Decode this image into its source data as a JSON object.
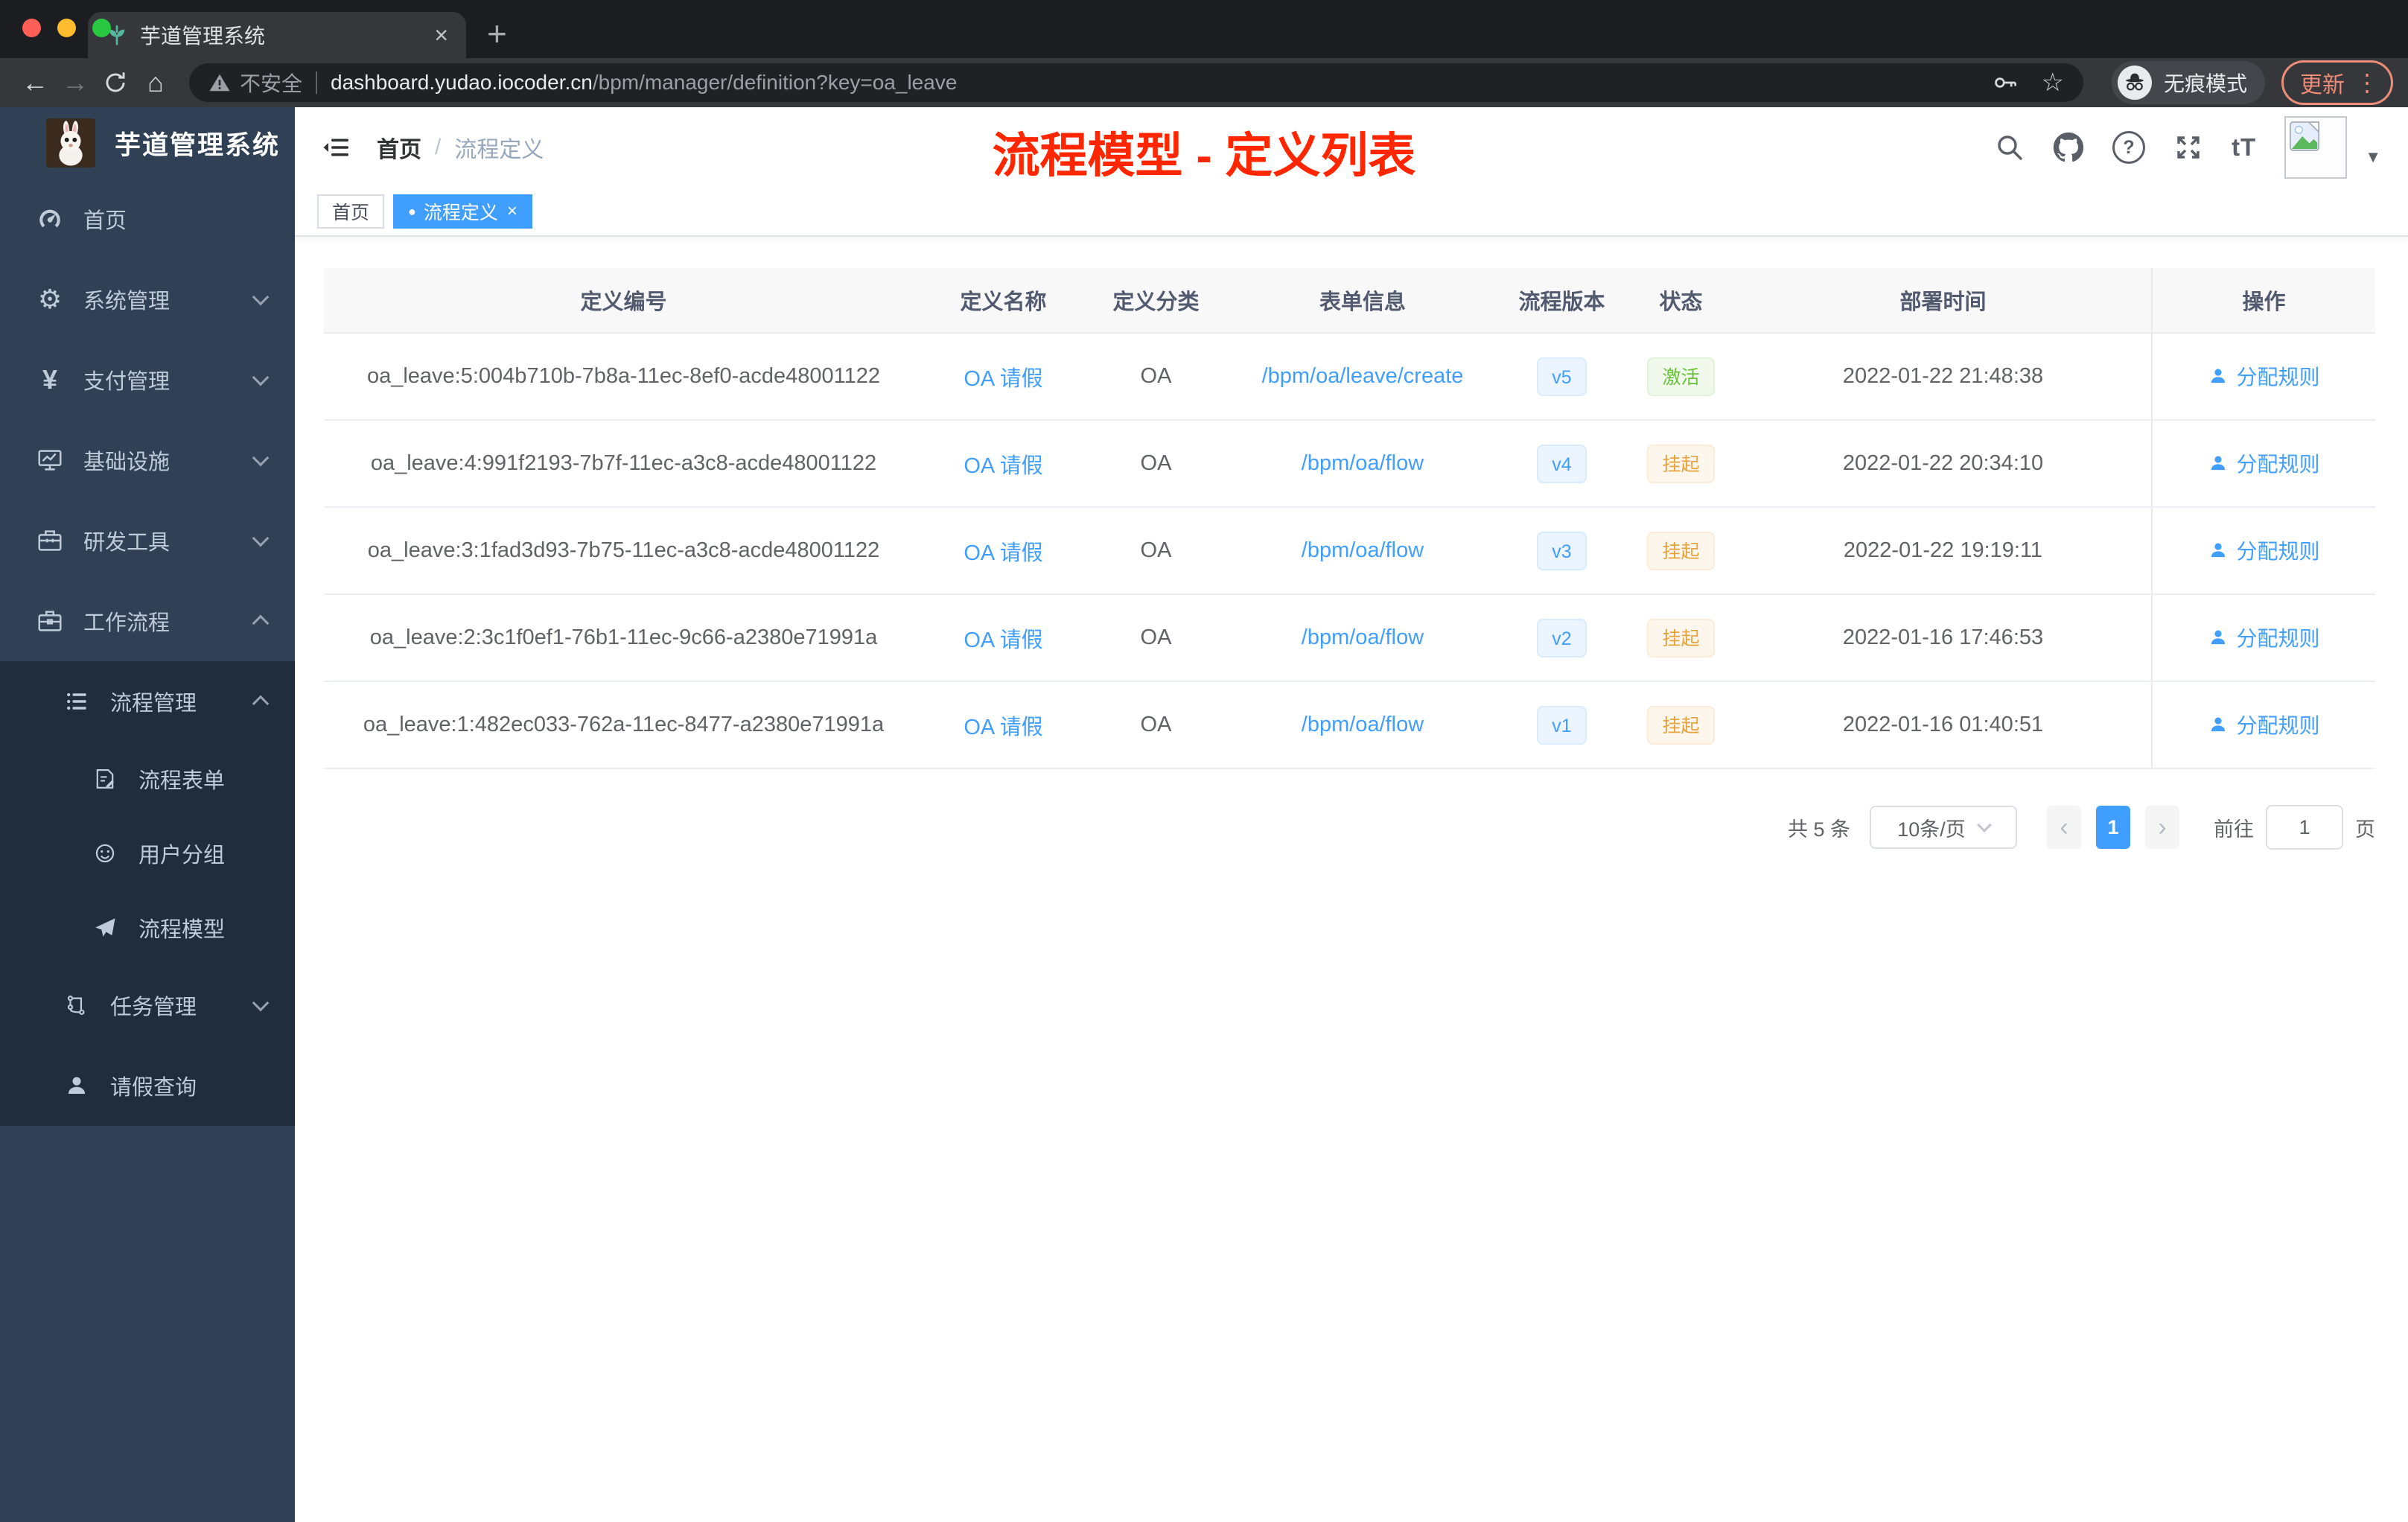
{
  "browser": {
    "tab_title": "芋道管理系统",
    "security_label": "不安全",
    "url_domain": "dashboard.yudao.iocoder.cn",
    "url_path": "/bpm/manager/definition?key=oa_leave",
    "incognito_label": "无痕模式",
    "update_label": "更新"
  },
  "icons": {
    "back": "←",
    "forward": "→",
    "home": "⌂",
    "star": "☆",
    "menu_dots": "⋮",
    "new_tab": "+",
    "tab_close": "×",
    "gear": "⚙",
    "yen": "¥",
    "question": "?",
    "font_size": "tT",
    "avatar_caret": "▼",
    "tag_dot": "●",
    "tag_close": "×",
    "prev": "‹",
    "next": "›",
    "breadcrumb_sep": "/"
  },
  "annotation": {
    "title": "流程模型 - 定义列表",
    "color": "#ff2600"
  },
  "sidebar": {
    "app_title": "芋道管理系统",
    "items": [
      {
        "label": "首页"
      },
      {
        "label": "系统管理"
      },
      {
        "label": "支付管理"
      },
      {
        "label": "基础设施"
      },
      {
        "label": "研发工具"
      },
      {
        "label": "工作流程"
      },
      {
        "label": "流程管理"
      },
      {
        "label": "流程表单"
      },
      {
        "label": "用户分组"
      },
      {
        "label": "流程模型"
      },
      {
        "label": "任务管理"
      },
      {
        "label": "请假查询"
      }
    ]
  },
  "header": {
    "breadcrumb_home": "首页",
    "breadcrumb_current": "流程定义"
  },
  "tags": [
    {
      "label": "首页",
      "active": false
    },
    {
      "label": "流程定义",
      "active": true
    }
  ],
  "table": {
    "columns": [
      "定义编号",
      "定义名称",
      "定义分类",
      "表单信息",
      "流程版本",
      "状态",
      "部署时间",
      "操作"
    ],
    "rows": [
      {
        "id": "oa_leave:5:004b710b-7b8a-11ec-8ef0-acde48001122",
        "name": "OA 请假",
        "category": "OA",
        "form": "/bpm/oa/leave/create",
        "version": "v5",
        "status": "激活",
        "status_type": "success",
        "deployed": "2022-01-22 21:48:38",
        "action": "分配规则"
      },
      {
        "id": "oa_leave:4:991f2193-7b7f-11ec-a3c8-acde48001122",
        "name": "OA 请假",
        "category": "OA",
        "form": "/bpm/oa/flow",
        "version": "v4",
        "status": "挂起",
        "status_type": "warning",
        "deployed": "2022-01-22 20:34:10",
        "action": "分配规则"
      },
      {
        "id": "oa_leave:3:1fad3d93-7b75-11ec-a3c8-acde48001122",
        "name": "OA 请假",
        "category": "OA",
        "form": "/bpm/oa/flow",
        "version": "v3",
        "status": "挂起",
        "status_type": "warning",
        "deployed": "2022-01-22 19:19:11",
        "action": "分配规则"
      },
      {
        "id": "oa_leave:2:3c1f0ef1-76b1-11ec-9c66-a2380e71991a",
        "name": "OA 请假",
        "category": "OA",
        "form": "/bpm/oa/flow",
        "version": "v2",
        "status": "挂起",
        "status_type": "warning",
        "deployed": "2022-01-16 17:46:53",
        "action": "分配规则"
      },
      {
        "id": "oa_leave:1:482ec033-762a-11ec-8477-a2380e71991a",
        "name": "OA 请假",
        "category": "OA",
        "form": "/bpm/oa/flow",
        "version": "v1",
        "status": "挂起",
        "status_type": "warning",
        "deployed": "2022-01-16 01:40:51",
        "action": "分配规则"
      }
    ]
  },
  "pagination": {
    "total": "共 5 条",
    "page_size": "10条/页",
    "page": "1",
    "goto_label": "前往",
    "goto_value": "1",
    "unit": "页"
  },
  "colors": {
    "accent": "#409eff",
    "sidebar_bg": "#304156",
    "submenu_bg": "#1f2d3d",
    "success": "#67c23a",
    "warning": "#e6a23c",
    "annotation_red": "#ff2600"
  }
}
